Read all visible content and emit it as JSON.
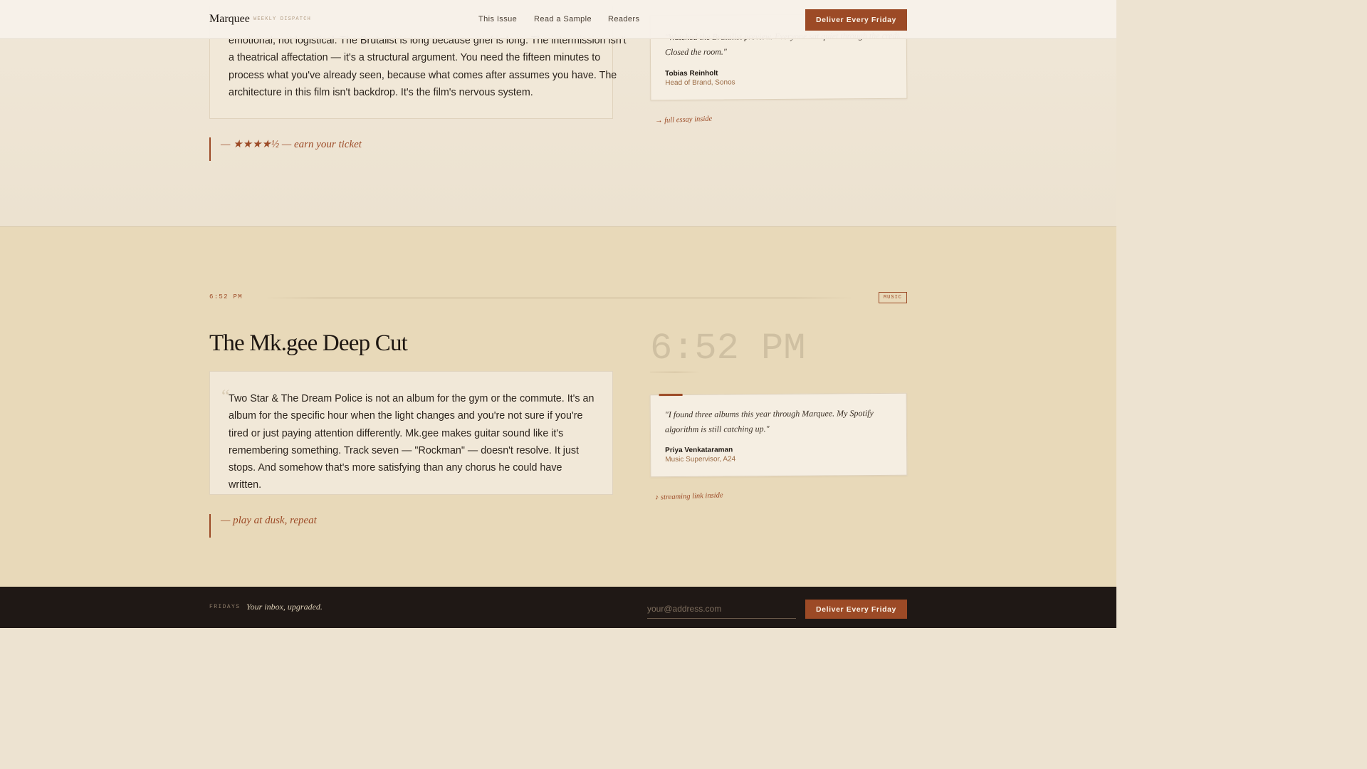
{
  "header": {
    "logo": "Marquee",
    "logo_sub": "WEEKLY DISPATCH",
    "nav": [
      "This Issue",
      "Read a Sample",
      "Readers"
    ],
    "cta": "Deliver Every Friday"
  },
  "prev_issue": {
    "body_lines": [
      "emotional, not logistical. The Brutalist is long because grief is long. The intermission isn't",
      "a theatrical affectation — it's a structural argument. You need the fifteen minutes to",
      "process what you've already seen, because what comes after assumes you have. The",
      "architecture in this film isn't backdrop. It's the film's nervous system."
    ],
    "pull": "— ★★★★½ — earn your ticket",
    "testimonial": {
      "quote_line1": "\"Watched the Brutalist preview. Everyone sat quiet through the credits.",
      "quote_line2": "Closed the room.\"",
      "name": "Tobias Reinholt",
      "role": "Head of Brand, Sonos"
    },
    "note": "→ full essay inside"
  },
  "music": {
    "time": "6:52 PM",
    "tag": "MUSIC",
    "title": "The Mk.gee Deep Cut",
    "quote_mark": "“",
    "body": "Two Star & The Dream Police is not an album for the gym or the commute. It's an album for the specific hour when the light changes and you're not sure if you're tired or just paying attention differently. Mk.gee makes guitar sound like it's remembering something. Track seven — \"Rockman\" — doesn't resolve. It just stops. And somehow that's more satisfying than any chorus he could have written.",
    "pull": "— play at dusk, repeat",
    "big_time": "6:52 PM",
    "testimonial": {
      "quote": "\"I found three albums this year through Marquee. My Spotify algorithm is still catching up.\"",
      "name": "Priya Venkataraman",
      "role": "Music Supervisor, A24"
    },
    "note": "♪ streaming link inside"
  },
  "footer": {
    "label": "FRIDAYS",
    "tagline": "Your inbox, upgraded.",
    "email_placeholder": "your@address.com",
    "cta": "Deliver Every Friday"
  },
  "colors": {
    "accent": "#9c4a26",
    "page": "#ede3d1",
    "music_bg": "#e8d9b9",
    "footer_bg": "#1f1815"
  }
}
